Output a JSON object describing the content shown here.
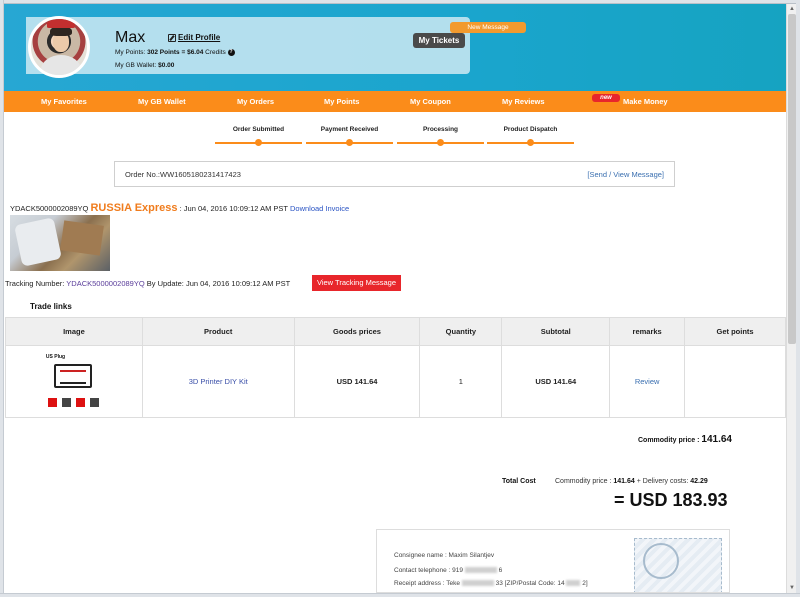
{
  "profile": {
    "name": "Max",
    "edit_profile": "Edit Profile",
    "points_label": "My Points:",
    "points_value": "302 Points = $6.04",
    "credits": "Credits",
    "help": "?",
    "wallet_label": "My GB Wallet:",
    "wallet_value": "$0.00",
    "my_tickets": "My Tickets",
    "new_message": "New Message"
  },
  "nav": {
    "items": [
      {
        "label": "My Favorites"
      },
      {
        "label": "My GB Wallet"
      },
      {
        "label": "My Orders"
      },
      {
        "label": "My Points"
      },
      {
        "label": "My Coupon"
      },
      {
        "label": "My Reviews"
      },
      {
        "label": "Make Money"
      }
    ],
    "new_badge": "new"
  },
  "steps": [
    {
      "label": "Order Submitted"
    },
    {
      "label": "Payment Received"
    },
    {
      "label": "Processing"
    },
    {
      "label": "Product Dispatch"
    }
  ],
  "order": {
    "order_no": "Order No.:WW1605180231417423",
    "send_view_message": "[Send / View Message]"
  },
  "shipment": {
    "code": "YDACK5000002089YQ",
    "carrier": "RUSSIA Express",
    "date": ": Jun 04, 2016 10:09:12 AM PST",
    "download_invoice": "Download Invoice",
    "tracking_label": "Tracking Number:",
    "tracking_number": "YDACK5000002089YQ",
    "update_text": "By Update: Jun 04, 2016 10:09:12 AM PST",
    "view_tracking": "View Tracking Message"
  },
  "trade": {
    "title": "Trade links",
    "headers": [
      "Image",
      "Product",
      "Goods prices",
      "Quantity",
      "Subtotal",
      "remarks",
      "Get points"
    ],
    "rows": [
      {
        "thumb_label": "US Plug",
        "product": "3D Printer DIY Kit",
        "price": "USD 141.64",
        "quantity": "1",
        "subtotal": "USD 141.64",
        "remarks": "Review",
        "points": ""
      }
    ]
  },
  "totals": {
    "commodity_label": "Commodity price :",
    "commodity_value": "141.64",
    "total_cost": "Total Cost",
    "detail_prefix": "Commodity price :",
    "detail_commodity": "141.64",
    "detail_delivery_label": "+ Delivery costs:",
    "detail_delivery": "42.29",
    "grand_total": "= USD 183.93"
  },
  "address": {
    "consignee": "Consignee name : Maxim Silantjev",
    "phone_prefix": "Contact telephone : 919",
    "phone_suffix": "6",
    "receipt_prefix": "Receipt address : Teke",
    "receipt_mid": "33 [ZIP/Postal Code: 14",
    "receipt_suffix": "2]"
  },
  "colors": {
    "accent_orange": "#fb8c1a",
    "header_blue": "#1aa5cd",
    "red": "#e8262b",
    "link_blue": "#2a54c4"
  }
}
